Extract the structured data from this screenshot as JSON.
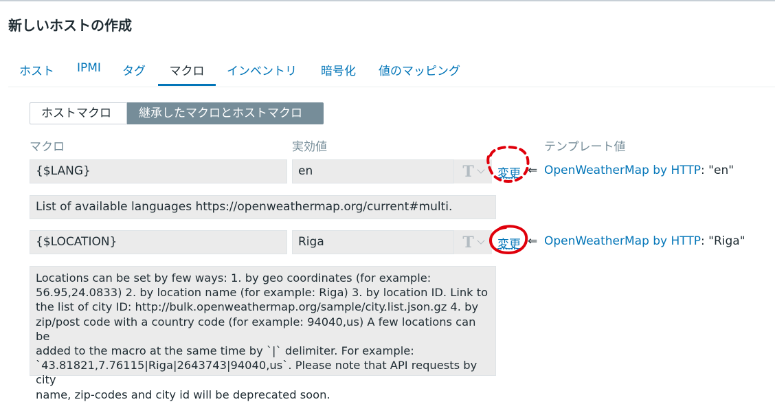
{
  "page": {
    "title": "新しいホストの作成"
  },
  "tabs": [
    {
      "label": "ホスト"
    },
    {
      "label": "IPMI"
    },
    {
      "label": "タグ"
    },
    {
      "label": "マクロ",
      "active": true
    },
    {
      "label": "インベントリ"
    },
    {
      "label": "暗号化"
    },
    {
      "label": "値のマッピング"
    }
  ],
  "segmented": {
    "host_macros": "ホストマクロ",
    "inherited_macros": "継承したマクロとホストマクロ",
    "selected": "inherited_macros"
  },
  "columns": {
    "macro": "マクロ",
    "effective_value": "実効値",
    "template_value": "テンプレート値"
  },
  "macros": [
    {
      "macro": "{$LANG}",
      "value": "en",
      "change_label": "変更",
      "arrow": "⇐",
      "template": "OpenWeatherMap by HTTP",
      "template_value": ": \"en\"",
      "description": "List of available languages https://openweathermap.org/current#multi."
    },
    {
      "macro": "{$LOCATION}",
      "value": "Riga",
      "change_label": "変更",
      "arrow": "⇐",
      "template": "OpenWeatherMap by HTTP",
      "template_value": ": \"Riga\"",
      "description_lines": [
        "Locations can be set by few ways: 1. by geo coordinates (for example:",
        "56.95,24.0833) 2. by location name (for example: Riga) 3. by location ID. Link to",
        "the list of city ID: http://bulk.openweathermap.org/sample/city.list.json.gz 4. by",
        "zip/post code with a country code (for example: 94040,us) A few locations can be",
        "added to the macro at the same time by `|` delimiter.  For example:",
        "`43.81821,7.76115|Riga|2643743|94040,us`. Please note that API requests by city",
        "name, zip-codes and city id will be deprecated soon."
      ]
    }
  ],
  "colors": {
    "link": "#0275b8",
    "accent": "#768d99",
    "annotation": "#e0000b"
  },
  "icons": {
    "type_selector": "text-type-icon",
    "dropdown": "chevron-down-icon"
  }
}
